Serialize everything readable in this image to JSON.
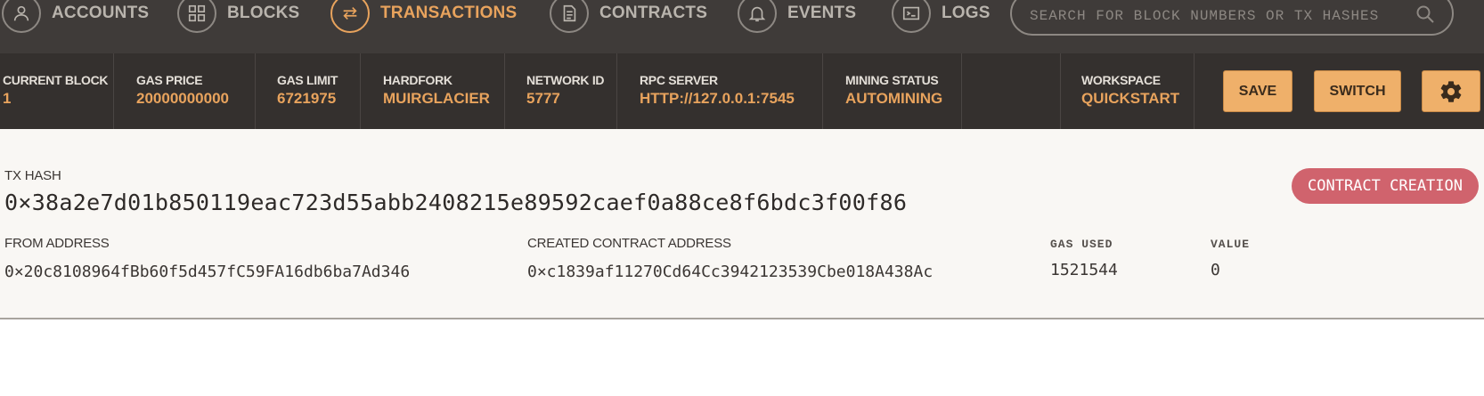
{
  "nav": {
    "items": [
      {
        "label": "ACCOUNTS",
        "icon": "person-icon"
      },
      {
        "label": "BLOCKS",
        "icon": "blocks-icon"
      },
      {
        "label": "TRANSACTIONS",
        "icon": "swap-arrows-icon",
        "active": true
      },
      {
        "label": "CONTRACTS",
        "icon": "document-icon"
      },
      {
        "label": "EVENTS",
        "icon": "bell-icon"
      },
      {
        "label": "LOGS",
        "icon": "terminal-icon"
      }
    ],
    "search_placeholder": "SEARCH FOR BLOCK NUMBERS OR TX HASHES"
  },
  "status": {
    "current_block": {
      "label": "CURRENT BLOCK",
      "value": "1"
    },
    "gas_price": {
      "label": "GAS PRICE",
      "value": "20000000000"
    },
    "gas_limit": {
      "label": "GAS LIMIT",
      "value": "6721975"
    },
    "hardfork": {
      "label": "HARDFORK",
      "value": "MUIRGLACIER"
    },
    "network_id": {
      "label": "NETWORK ID",
      "value": "5777"
    },
    "rpc_server": {
      "label": "RPC SERVER",
      "value": "HTTP://127.0.0.1:7545"
    },
    "mining_status": {
      "label": "MINING STATUS",
      "value": "AUTOMINING"
    },
    "workspace": {
      "label": "WORKSPACE",
      "value": "QUICKSTART"
    },
    "save_label": "SAVE",
    "switch_label": "SWITCH"
  },
  "tx": {
    "hash_label": "TX HASH",
    "hash": "0×38a2e7d01b850119eac723d55abb2408215e89592caef0a88ce8f6bdc3f00f86",
    "badge": "CONTRACT CREATION",
    "from_label": "FROM ADDRESS",
    "from": "0×20c8108964fBb60f5d457fC59FA16db6ba7Ad346",
    "contract_label": "CREATED CONTRACT ADDRESS",
    "contract": "0×c1839af11270Cd64Cc3942123539Cbe018A438Ac",
    "gas_used_label": "GAS USED",
    "gas_used": "1521544",
    "value_label": "VALUE",
    "value": "0"
  },
  "colors": {
    "accent": "#e8a35d",
    "nav_bg": "#3f3b39",
    "status_bg": "#34302e",
    "badge": "#d0636d"
  }
}
